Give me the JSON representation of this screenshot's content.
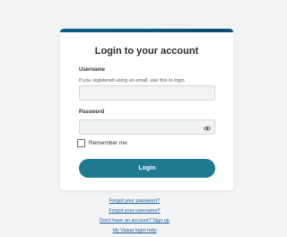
{
  "login": {
    "title": "Login to your account",
    "username_label": "Username",
    "username_hint": "If you registered using an email, use this to login",
    "username_value": "",
    "password_label": "Password",
    "password_value": "",
    "remember_label": "Remember me",
    "remember_checked": false,
    "login_button": "Login"
  },
  "links": [
    "Forgot your password?",
    "Forgot your username?",
    "Don't have an account? Sign up",
    "My Vaisar login help"
  ],
  "colors": {
    "accent": "#0c5f8a",
    "button": "#1d7a91",
    "link": "#1a5d9c",
    "background": "#f1f3f4"
  },
  "icons": [
    "eye-icon"
  ]
}
